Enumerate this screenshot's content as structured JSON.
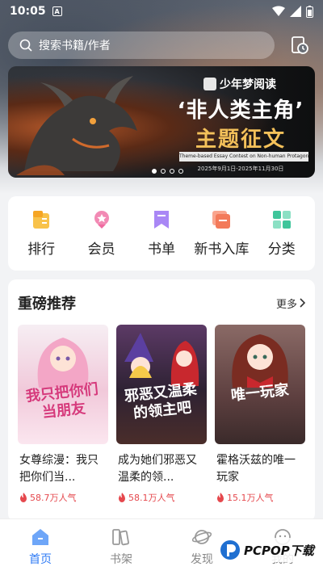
{
  "status_bar": {
    "time": "10:05",
    "badge": "A"
  },
  "search": {
    "placeholder": "搜索书籍/作者"
  },
  "banner": {
    "brand": "少年梦阅读",
    "title_line1": "‘非人类主角’",
    "title_line2": "主题征文",
    "subtitle_en": "Theme-based Essay Contest on Non-human Protagonists",
    "dates": "2025年9月1日-2025年11月30日",
    "dot_count": 4,
    "active_dot": 0
  },
  "quick_links": [
    {
      "label": "排行",
      "icon": "ranking-icon",
      "color": "#f5a524"
    },
    {
      "label": "会员",
      "icon": "vip-icon",
      "color": "#ef6aa0"
    },
    {
      "label": "书单",
      "icon": "booklist-icon",
      "color": "#8b5cf6"
    },
    {
      "label": "新书入库",
      "icon": "new-books-icon",
      "color": "#f37a5a"
    },
    {
      "label": "分类",
      "icon": "category-icon",
      "color": "#3fc59b"
    }
  ],
  "recommend": {
    "title": "重磅推荐",
    "more": "更多",
    "books": [
      {
        "title": "女尊综漫：我只把你们当...",
        "popularity": "58.7万人气",
        "cover_text": "我只把你们当朋友",
        "cover_bg": "#f3eef2",
        "cover_text_color": "#d63a7c"
      },
      {
        "title": "成为她们邪恶又温柔的领...",
        "popularity": "58.1万人气",
        "cover_text": "邪恶又温柔的领主吧",
        "cover_bg": "#3a2a40",
        "cover_text_color": "#ffffff"
      },
      {
        "title": "霍格沃兹的唯一玩家",
        "popularity": "15.1万人气",
        "cover_text": "唯一玩家",
        "cover_bg": "#6b4a4a",
        "cover_text_color": "#ffffff"
      }
    ]
  },
  "bottom_nav": [
    {
      "label": "首页",
      "icon": "home-icon",
      "active": true
    },
    {
      "label": "书架",
      "icon": "bookshelf-icon",
      "active": false
    },
    {
      "label": "发现",
      "icon": "discover-icon",
      "active": false
    },
    {
      "label": "我的",
      "icon": "profile-icon",
      "active": false
    }
  ],
  "watermark": {
    "text": "PCPOP下载"
  },
  "colors": {
    "accent": "#2f7bf5",
    "popularity": "#e5484d"
  }
}
